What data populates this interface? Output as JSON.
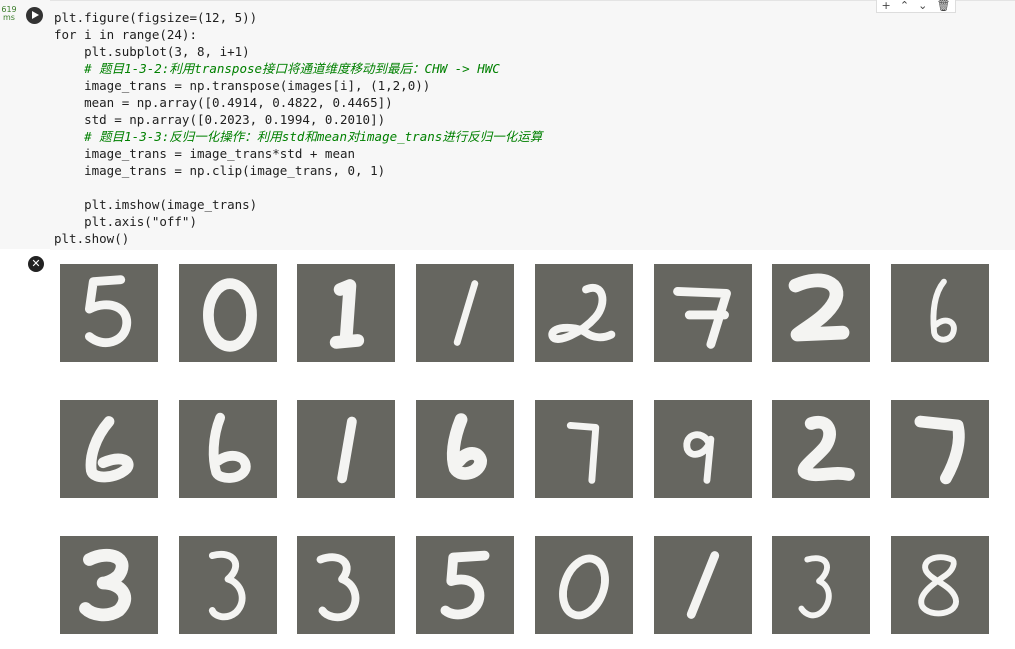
{
  "cell": {
    "exec_time_value": "619",
    "exec_time_unit": "ms",
    "code_lines": [
      "plt.figure(figsize=(12, 5))",
      "for i in range(24):",
      "    plt.subplot(3, 8, i+1)",
      "    # 题目1-3-2:利用transpose接口将通道维度移动到最后：CHW -> HWC",
      "    image_trans = np.transpose(images[i], (1,2,0))",
      "    mean = np.array([0.4914, 0.4822, 0.4465])",
      "    std = np.array([0.2023, 0.1994, 0.2010])",
      "    # 题目1-3-3:反归一化操作：利用std和mean对image_trans进行反归一化运算",
      "    image_trans = image_trans*std + mean",
      "    image_trans = np.clip(image_trans, 0, 1)",
      "",
      "    plt.imshow(image_trans)",
      "    plt.axis(\"off\")",
      "plt.show()"
    ]
  },
  "toolbar": {
    "add_icon": "+",
    "up_icon": "⌃",
    "down_icon": "⌄",
    "delete_icon": "🗑"
  },
  "output": {
    "clear_icon": "✕",
    "digits": [
      "5",
      "0",
      "1",
      "1",
      "2",
      "7",
      "2",
      "6",
      "6",
      "6",
      "1",
      "6",
      "7",
      "9",
      "2",
      "7",
      "3",
      "3",
      "3",
      "5",
      "0",
      "1",
      "3",
      "8"
    ]
  },
  "colors": {
    "image_background": "#666660",
    "digit_stroke": "#f4f4f2"
  }
}
